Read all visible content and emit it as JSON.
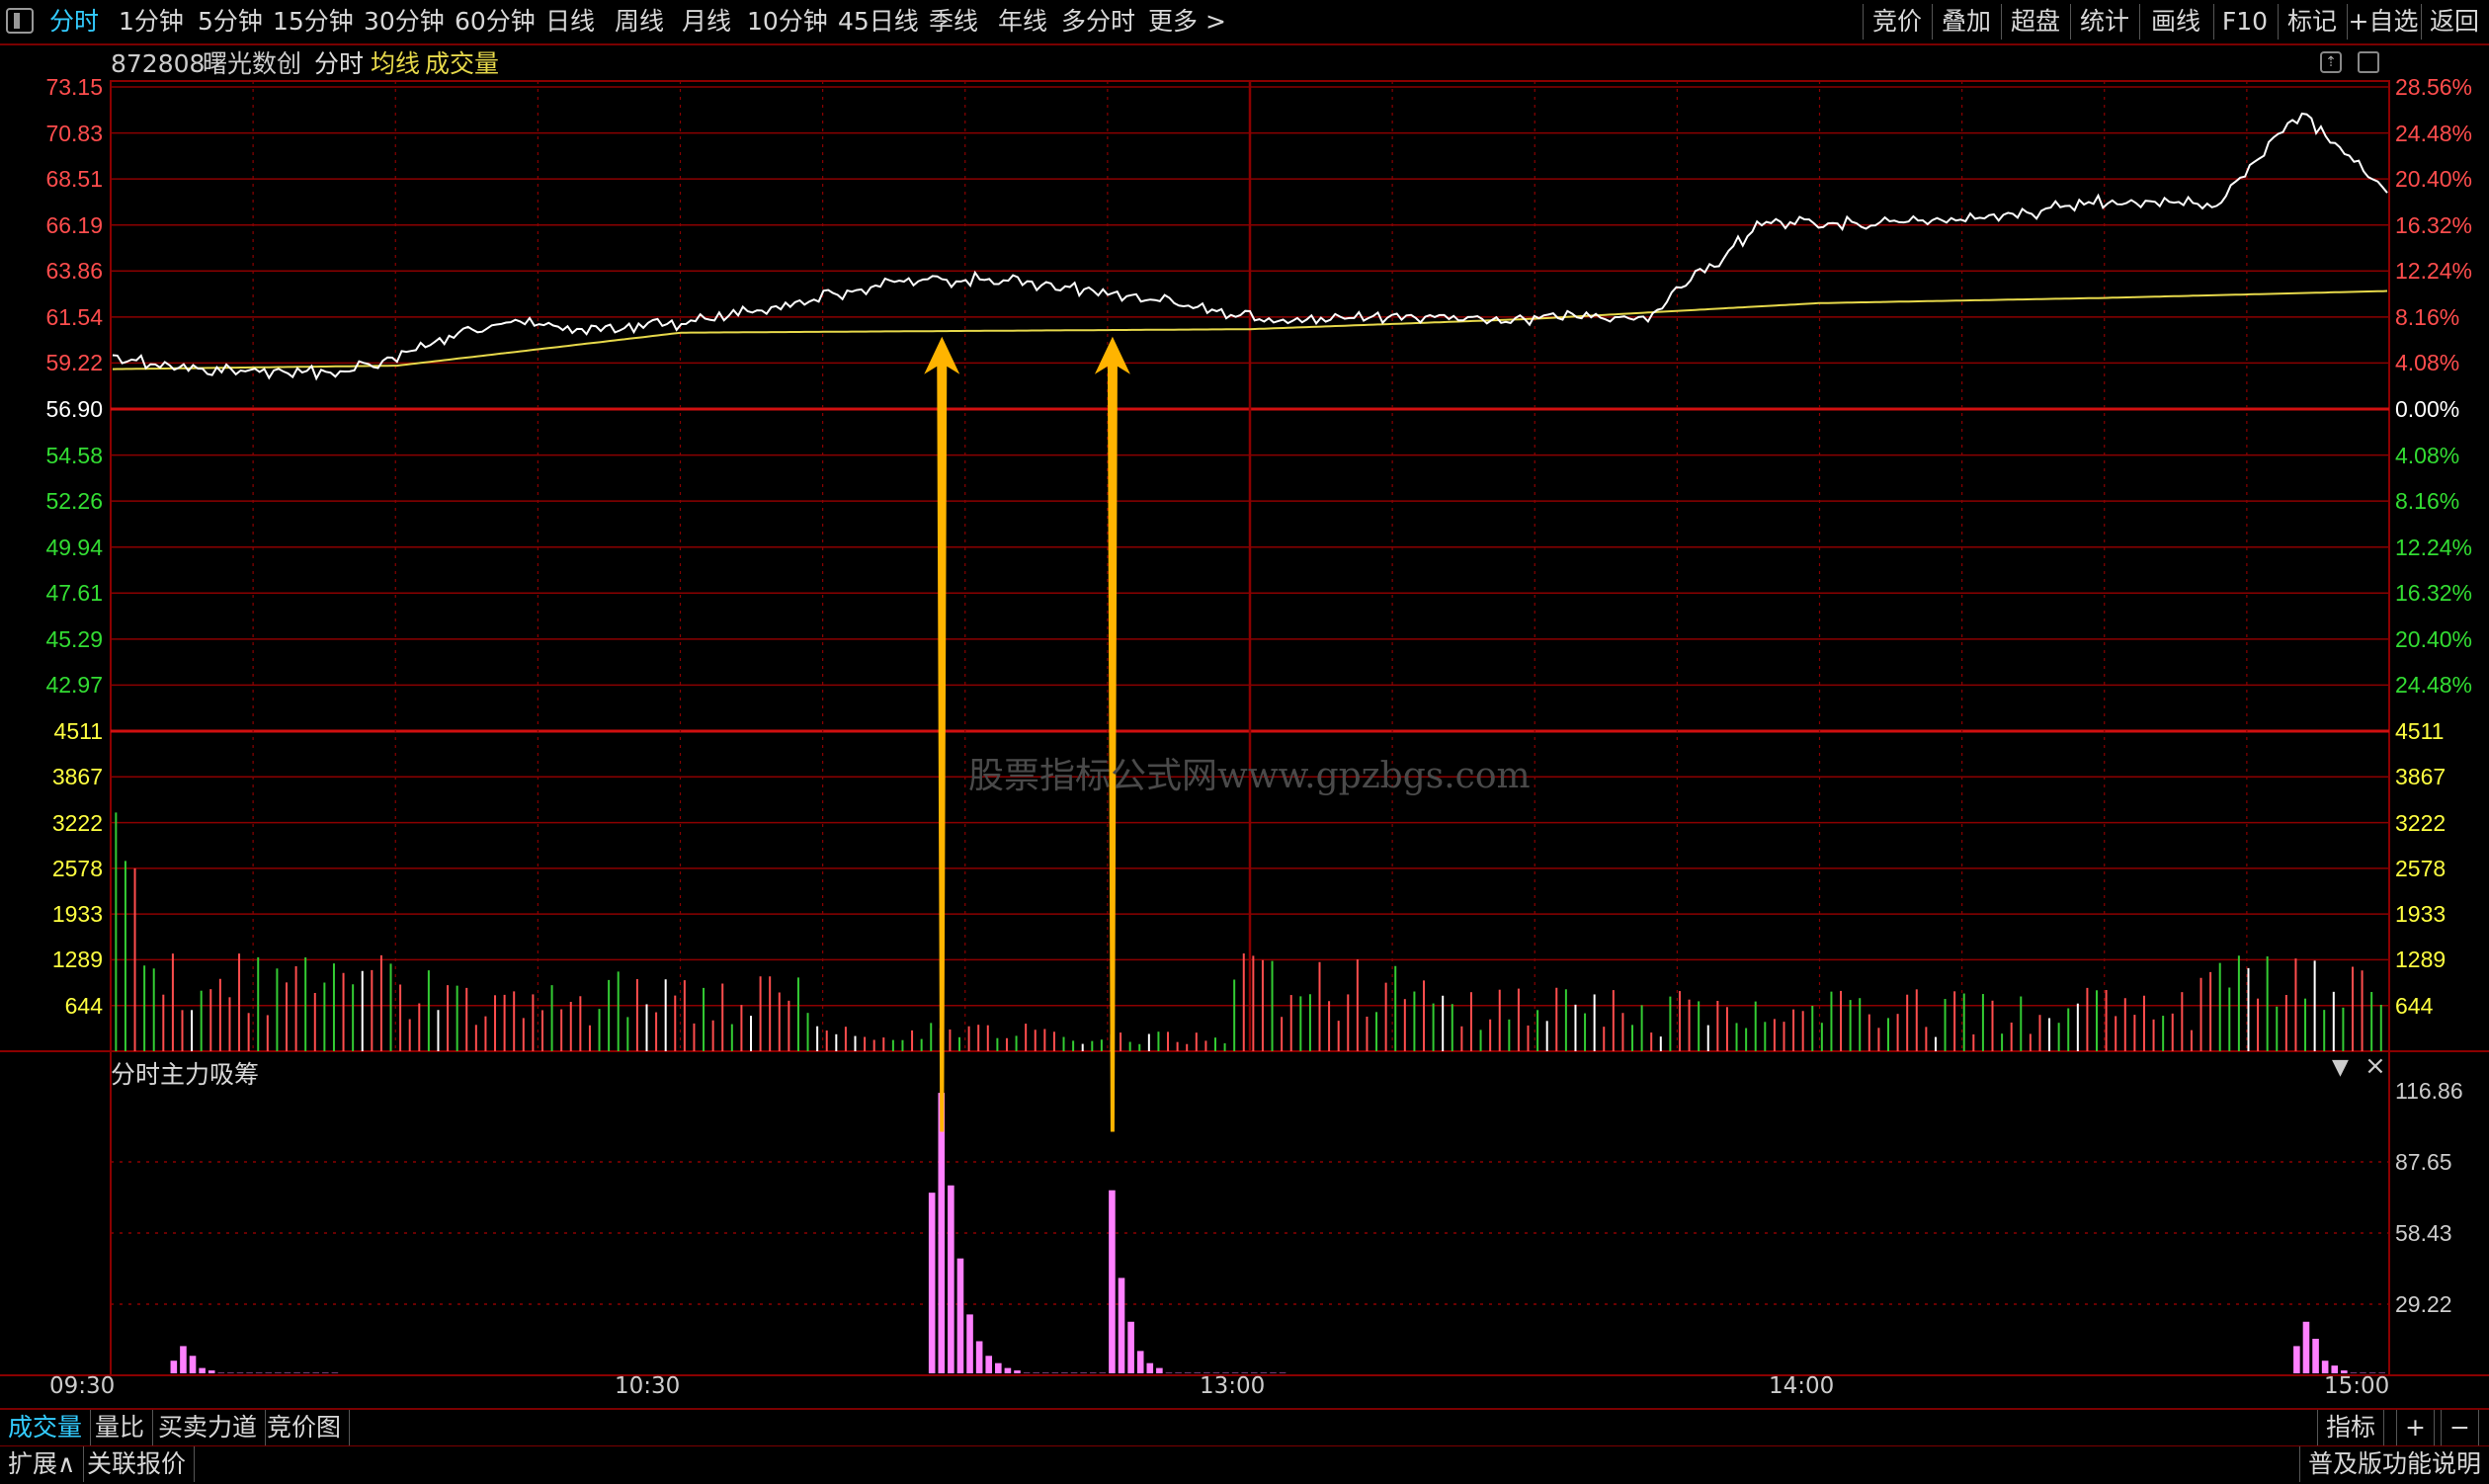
{
  "toolbar": {
    "tabs": [
      "分时",
      "1分钟",
      "5分钟",
      "15分钟",
      "30分钟",
      "60分钟",
      "日线",
      "周线",
      "月线",
      "10分钟",
      "45日线",
      "季线",
      "年线",
      "多分时",
      "更多 >"
    ],
    "right_buttons": [
      "竞价",
      "叠加",
      "超盘",
      "统计",
      "画线",
      "F10",
      "标记",
      "+自选",
      "返回"
    ]
  },
  "info": {
    "code": "872808",
    "name": "曙光数创",
    "mode": "分时",
    "avg_label": "均线",
    "vol_label": "成交量"
  },
  "price_axis": {
    "left_upper": [
      "73.15",
      "70.83",
      "68.51",
      "66.19",
      "63.86",
      "61.54",
      "59.22"
    ],
    "base": "56.90",
    "left_lower": [
      "54.58",
      "52.26",
      "49.94",
      "47.61",
      "45.29",
      "42.97"
    ],
    "right_upper": [
      "28.56%",
      "24.48%",
      "20.40%",
      "16.32%",
      "12.24%",
      "8.16%",
      "4.08%"
    ],
    "right_base": "0.00%",
    "right_lower": [
      "4.08%",
      "8.16%",
      "12.24%",
      "16.32%",
      "20.40%",
      "24.48%"
    ]
  },
  "volume_axis": [
    "4511",
    "3867",
    "3222",
    "2578",
    "1933",
    "1289",
    "644"
  ],
  "indicator": {
    "title": "分时主力吸筹",
    "axis": [
      "116.86",
      "87.65",
      "58.43",
      "29.22"
    ]
  },
  "time_axis": [
    "09:30",
    "10:30",
    "13:00",
    "14:00",
    "15:00"
  ],
  "watermark": "股票指标公式网www.gpzbgs.com",
  "bottom_tabs": [
    "成交量",
    "量比",
    "买卖力道",
    "竞价图"
  ],
  "bottom_right": [
    "指标",
    "+",
    "−"
  ],
  "bottom_row2": [
    "扩展∧",
    "关联报价"
  ],
  "bottom_row2_right": "普及版功能说明",
  "colors": {
    "grid": "#8b0000",
    "price": "#ffffff",
    "avg": "#e6d84a",
    "up": "#ff4d4d",
    "down": "#33cc33",
    "flat": "#ffffff",
    "indicator": "#ff80ff",
    "arrow": "#ffb400"
  },
  "chart_data": {
    "type": "line",
    "series": [
      {
        "name": "分时",
        "x_hours": [
          0,
          0.1,
          0.25,
          0.4,
          0.55,
          0.7,
          0.85,
          1.0,
          1.2,
          1.4,
          1.6,
          1.8,
          2.0,
          2.1,
          2.3,
          2.5,
          2.7,
          2.9,
          3.1,
          3.3,
          3.5,
          3.7,
          3.85,
          4.0
        ],
        "values": [
          60.0,
          59.3,
          59.1,
          59.0,
          60.5,
          62.1,
          61.4,
          61.8,
          63.0,
          64.4,
          64.3,
          63.4,
          62.2,
          61.9,
          62.3,
          62.1,
          62.2,
          67.6,
          67.6,
          67.9,
          68.9,
          68.7,
          74.0,
          69.3
        ]
      },
      {
        "name": "均线",
        "x_hours": [
          0,
          0.5,
          1.0,
          2.0,
          2.5,
          3.0,
          3.5,
          4.0
        ],
        "values": [
          59.2,
          59.4,
          61.3,
          61.5,
          62.1,
          63.0,
          63.3,
          63.7
        ]
      }
    ],
    "ylim": [
      40.65,
      75.4
    ],
    "volume_max": 4511,
    "indicator_values_hint": [
      116.86,
      75.0,
      35.0,
      15.0
    ]
  }
}
